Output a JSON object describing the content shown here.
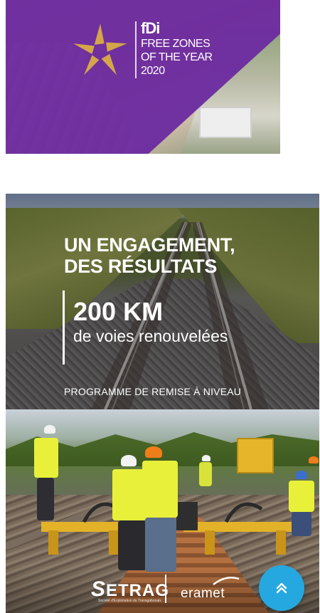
{
  "fdi_banner": {
    "logo": "fDi",
    "line1": "FREE ZONES",
    "line2": "OF THE YEAR",
    "year": "2020",
    "colors": {
      "purple": "#6c2aa0",
      "gold": "#d4a64a"
    }
  },
  "rail_banner": {
    "headline_line1": "UN ENGAGEMENT,",
    "headline_line2": "DES RÉSULTATS",
    "km_value": "200 KM",
    "km_subtitle": "de voies renouvelées",
    "program": "PROGRAMME DE REMISE À NIVEAU"
  },
  "workers_banner": {
    "logo_setrag": "ETRAG",
    "logo_setrag_initial": "S",
    "logo_setrag_tagline": "Société d'Exploitation du Transgabonais",
    "logo_eramet": "eramet",
    "colors": {
      "vest": "#e8f03a",
      "helmet_white": "#f2f2f2",
      "helmet_orange": "#ef7d1a",
      "machine": "#e6b52a"
    }
  },
  "scroll_top_button": {
    "icon": "double-chevron-up-icon",
    "color": "#25a8e0"
  }
}
